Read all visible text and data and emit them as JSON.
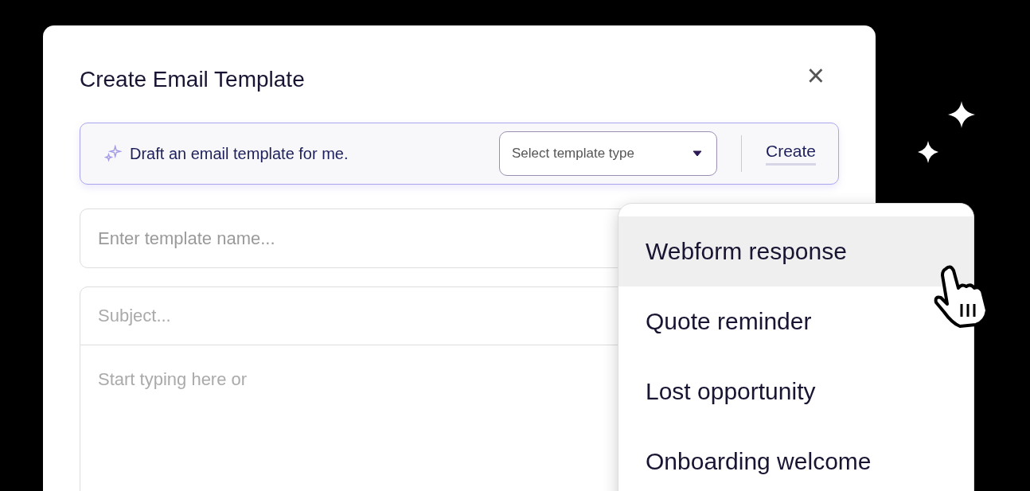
{
  "dialog": {
    "title": "Create Email Template",
    "close": "×"
  },
  "ai_draft": {
    "prompt": "Draft an email template for me.",
    "template_type": {
      "placeholder": "Select template type",
      "expanded": true
    },
    "create_button": "Create"
  },
  "name_field": {
    "placeholder": "Enter template name..."
  },
  "subject_field": {
    "placeholder": "Subject..."
  },
  "body_field": {
    "placeholder": "Start typing here or"
  },
  "template_menu": [
    {
      "label": "Webform response",
      "selected": true
    },
    {
      "label": "Quote reminder",
      "selected": false
    },
    {
      "label": "Lost opportunity",
      "selected": false
    },
    {
      "label": "Onboarding welcome",
      "selected": false
    }
  ]
}
